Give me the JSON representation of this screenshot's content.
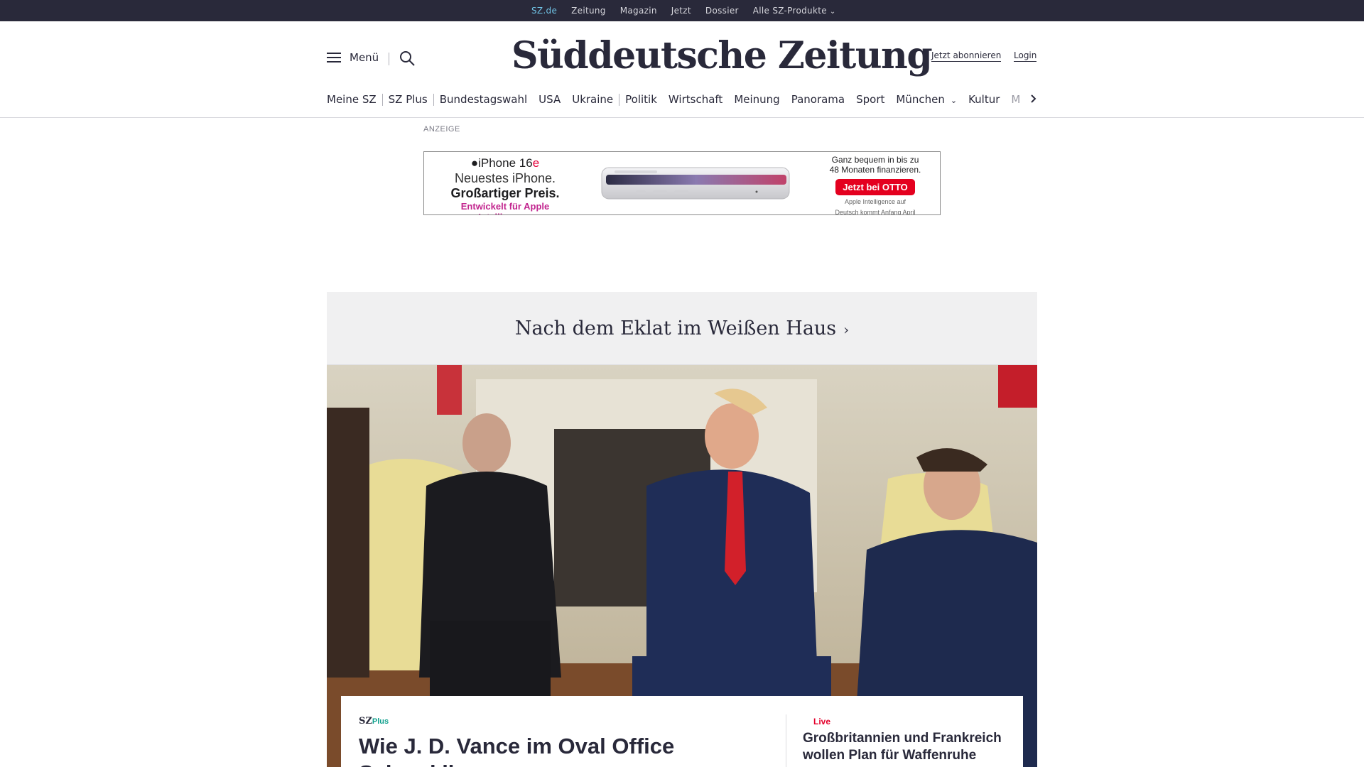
{
  "topbar": {
    "items": [
      "SZ.de",
      "Zeitung",
      "Magazin",
      "Jetzt",
      "Dossier",
      "Alle SZ-Produkte"
    ]
  },
  "header": {
    "menu_label": "Menü",
    "logo_text": "Süddeutsche Zeitung",
    "subscribe_label": "Jetzt abonnieren",
    "login_label": "Login"
  },
  "nav": {
    "items": [
      "Meine SZ",
      "SZ Plus",
      "Bundestagswahl",
      "USA",
      "Ukraine",
      "Politik",
      "Wirtschaft",
      "Meinung",
      "Panorama",
      "Sport",
      "München",
      "Kultur",
      "M"
    ]
  },
  "ad": {
    "label": "ANZEIGE",
    "product_prefix": "iPhone 16",
    "product_suffix": "e",
    "line1": "Neuestes iPhone.",
    "line2": "Großartiger Preis.",
    "line3": "Entwickelt für Apple Intelligence.",
    "right_line1": "Ganz bequem in bis zu",
    "right_line2": "48 Monaten finanzieren.",
    "cta": "Jetzt bei OTTO",
    "footnote1": "Apple Intelligence auf",
    "footnote2": "Deutsch kommt Anfang April"
  },
  "teaser_band": {
    "title": "Nach dem Eklat im Weißen Haus"
  },
  "main_story": {
    "badge_sz": "SZ",
    "badge_plus": "Plus",
    "headline": "Wie J. D. Vance im Oval Office Selenskij"
  },
  "side_story": {
    "kicker": "Live",
    "headline": "Großbritannien und Frankreich wollen Plan für Waffenruhe"
  },
  "colors": {
    "topbar_bg": "#29293a",
    "active_link": "#71c5e8",
    "sz_plus": "#0d9f8c",
    "live": "#e4002b",
    "otto_red": "#e4001f"
  }
}
